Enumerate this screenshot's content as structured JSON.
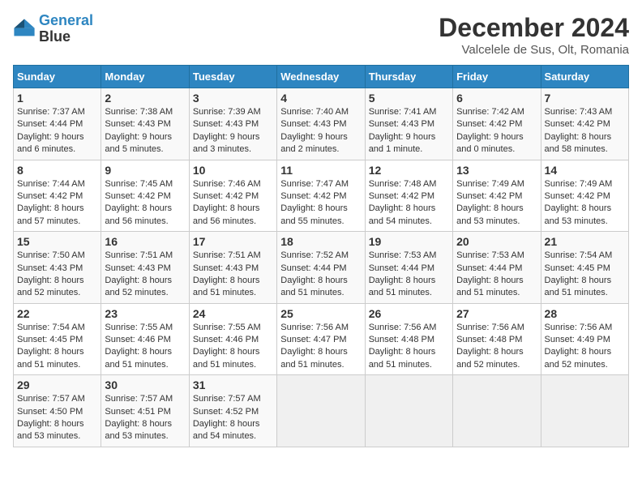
{
  "header": {
    "logo_line1": "General",
    "logo_line2": "Blue",
    "title": "December 2024",
    "subtitle": "Valcelele de Sus, Olt, Romania"
  },
  "columns": [
    "Sunday",
    "Monday",
    "Tuesday",
    "Wednesday",
    "Thursday",
    "Friday",
    "Saturday"
  ],
  "weeks": [
    [
      {
        "day": "1",
        "sunrise": "Sunrise: 7:37 AM",
        "sunset": "Sunset: 4:44 PM",
        "daylight": "Daylight: 9 hours and 6 minutes."
      },
      {
        "day": "2",
        "sunrise": "Sunrise: 7:38 AM",
        "sunset": "Sunset: 4:43 PM",
        "daylight": "Daylight: 9 hours and 5 minutes."
      },
      {
        "day": "3",
        "sunrise": "Sunrise: 7:39 AM",
        "sunset": "Sunset: 4:43 PM",
        "daylight": "Daylight: 9 hours and 3 minutes."
      },
      {
        "day": "4",
        "sunrise": "Sunrise: 7:40 AM",
        "sunset": "Sunset: 4:43 PM",
        "daylight": "Daylight: 9 hours and 2 minutes."
      },
      {
        "day": "5",
        "sunrise": "Sunrise: 7:41 AM",
        "sunset": "Sunset: 4:43 PM",
        "daylight": "Daylight: 9 hours and 1 minute."
      },
      {
        "day": "6",
        "sunrise": "Sunrise: 7:42 AM",
        "sunset": "Sunset: 4:42 PM",
        "daylight": "Daylight: 9 hours and 0 minutes."
      },
      {
        "day": "7",
        "sunrise": "Sunrise: 7:43 AM",
        "sunset": "Sunset: 4:42 PM",
        "daylight": "Daylight: 8 hours and 58 minutes."
      }
    ],
    [
      {
        "day": "8",
        "sunrise": "Sunrise: 7:44 AM",
        "sunset": "Sunset: 4:42 PM",
        "daylight": "Daylight: 8 hours and 57 minutes."
      },
      {
        "day": "9",
        "sunrise": "Sunrise: 7:45 AM",
        "sunset": "Sunset: 4:42 PM",
        "daylight": "Daylight: 8 hours and 56 minutes."
      },
      {
        "day": "10",
        "sunrise": "Sunrise: 7:46 AM",
        "sunset": "Sunset: 4:42 PM",
        "daylight": "Daylight: 8 hours and 56 minutes."
      },
      {
        "day": "11",
        "sunrise": "Sunrise: 7:47 AM",
        "sunset": "Sunset: 4:42 PM",
        "daylight": "Daylight: 8 hours and 55 minutes."
      },
      {
        "day": "12",
        "sunrise": "Sunrise: 7:48 AM",
        "sunset": "Sunset: 4:42 PM",
        "daylight": "Daylight: 8 hours and 54 minutes."
      },
      {
        "day": "13",
        "sunrise": "Sunrise: 7:49 AM",
        "sunset": "Sunset: 4:42 PM",
        "daylight": "Daylight: 8 hours and 53 minutes."
      },
      {
        "day": "14",
        "sunrise": "Sunrise: 7:49 AM",
        "sunset": "Sunset: 4:42 PM",
        "daylight": "Daylight: 8 hours and 53 minutes."
      }
    ],
    [
      {
        "day": "15",
        "sunrise": "Sunrise: 7:50 AM",
        "sunset": "Sunset: 4:43 PM",
        "daylight": "Daylight: 8 hours and 52 minutes."
      },
      {
        "day": "16",
        "sunrise": "Sunrise: 7:51 AM",
        "sunset": "Sunset: 4:43 PM",
        "daylight": "Daylight: 8 hours and 52 minutes."
      },
      {
        "day": "17",
        "sunrise": "Sunrise: 7:51 AM",
        "sunset": "Sunset: 4:43 PM",
        "daylight": "Daylight: 8 hours and 51 minutes."
      },
      {
        "day": "18",
        "sunrise": "Sunrise: 7:52 AM",
        "sunset": "Sunset: 4:44 PM",
        "daylight": "Daylight: 8 hours and 51 minutes."
      },
      {
        "day": "19",
        "sunrise": "Sunrise: 7:53 AM",
        "sunset": "Sunset: 4:44 PM",
        "daylight": "Daylight: 8 hours and 51 minutes."
      },
      {
        "day": "20",
        "sunrise": "Sunrise: 7:53 AM",
        "sunset": "Sunset: 4:44 PM",
        "daylight": "Daylight: 8 hours and 51 minutes."
      },
      {
        "day": "21",
        "sunrise": "Sunrise: 7:54 AM",
        "sunset": "Sunset: 4:45 PM",
        "daylight": "Daylight: 8 hours and 51 minutes."
      }
    ],
    [
      {
        "day": "22",
        "sunrise": "Sunrise: 7:54 AM",
        "sunset": "Sunset: 4:45 PM",
        "daylight": "Daylight: 8 hours and 51 minutes."
      },
      {
        "day": "23",
        "sunrise": "Sunrise: 7:55 AM",
        "sunset": "Sunset: 4:46 PM",
        "daylight": "Daylight: 8 hours and 51 minutes."
      },
      {
        "day": "24",
        "sunrise": "Sunrise: 7:55 AM",
        "sunset": "Sunset: 4:46 PM",
        "daylight": "Daylight: 8 hours and 51 minutes."
      },
      {
        "day": "25",
        "sunrise": "Sunrise: 7:56 AM",
        "sunset": "Sunset: 4:47 PM",
        "daylight": "Daylight: 8 hours and 51 minutes."
      },
      {
        "day": "26",
        "sunrise": "Sunrise: 7:56 AM",
        "sunset": "Sunset: 4:48 PM",
        "daylight": "Daylight: 8 hours and 51 minutes."
      },
      {
        "day": "27",
        "sunrise": "Sunrise: 7:56 AM",
        "sunset": "Sunset: 4:48 PM",
        "daylight": "Daylight: 8 hours and 52 minutes."
      },
      {
        "day": "28",
        "sunrise": "Sunrise: 7:56 AM",
        "sunset": "Sunset: 4:49 PM",
        "daylight": "Daylight: 8 hours and 52 minutes."
      }
    ],
    [
      {
        "day": "29",
        "sunrise": "Sunrise: 7:57 AM",
        "sunset": "Sunset: 4:50 PM",
        "daylight": "Daylight: 8 hours and 53 minutes."
      },
      {
        "day": "30",
        "sunrise": "Sunrise: 7:57 AM",
        "sunset": "Sunset: 4:51 PM",
        "daylight": "Daylight: 8 hours and 53 minutes."
      },
      {
        "day": "31",
        "sunrise": "Sunrise: 7:57 AM",
        "sunset": "Sunset: 4:52 PM",
        "daylight": "Daylight: 8 hours and 54 minutes."
      },
      null,
      null,
      null,
      null
    ]
  ]
}
